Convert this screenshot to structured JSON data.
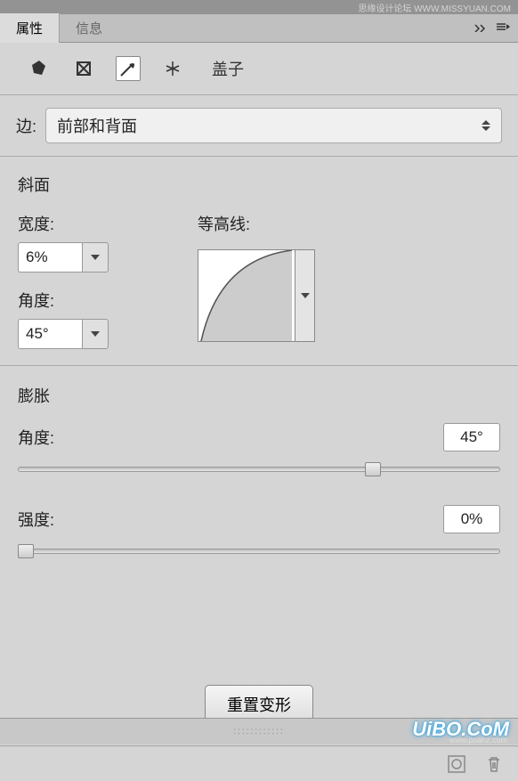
{
  "tabs": {
    "properties": "属性",
    "info": "信息"
  },
  "toolbar": {
    "object_label": "盖子"
  },
  "side": {
    "label": "边:",
    "value": "前部和背面"
  },
  "bevel": {
    "title": "斜面",
    "width_label": "宽度:",
    "width_value": "6%",
    "angle_label": "角度:",
    "angle_value": "45°",
    "contour_label": "等高线:"
  },
  "inflate": {
    "title": "膨胀",
    "angle_label": "角度:",
    "angle_value": "45°",
    "strength_label": "强度:",
    "strength_value": "0%"
  },
  "reset_label": "重置变形",
  "watermark": {
    "top": "思缘设计论坛 WWW.MISSYUAN.COM",
    "logo": "UiBO.CoM",
    "sub": "www.psahz.com"
  }
}
